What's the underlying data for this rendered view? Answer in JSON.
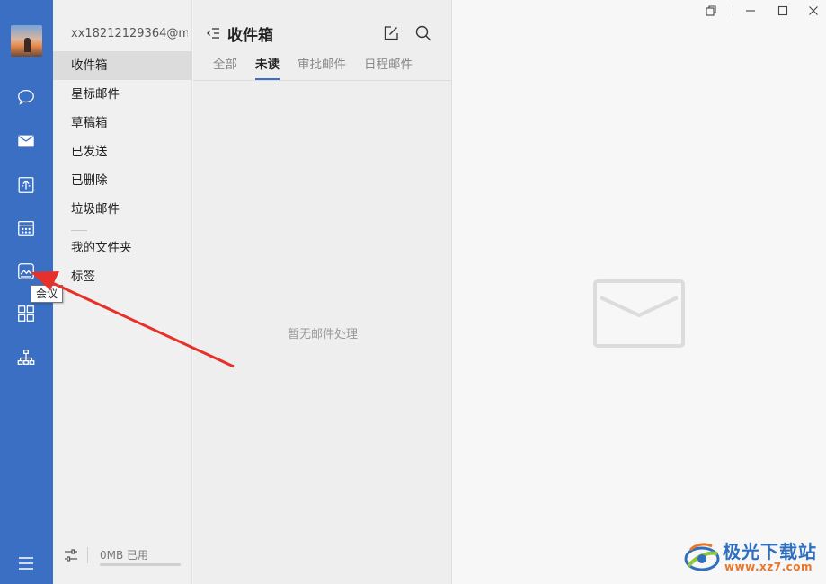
{
  "rail": {
    "items": [
      {
        "name": "chat",
        "icon": "chat-bubble-icon"
      },
      {
        "name": "mail",
        "icon": "mail-icon"
      },
      {
        "name": "docs",
        "icon": "document-icon"
      },
      {
        "name": "calendar",
        "icon": "calendar-icon"
      },
      {
        "name": "meeting",
        "icon": "meeting-icon"
      },
      {
        "name": "apps",
        "icon": "apps-grid-icon"
      },
      {
        "name": "org",
        "icon": "org-chart-icon"
      }
    ],
    "tooltip": "会议",
    "menu_icon": "hamburger-menu-icon"
  },
  "folders": {
    "account": "xx18212129364@m...",
    "items": [
      {
        "label": "收件箱",
        "active": true
      },
      {
        "label": "星标邮件"
      },
      {
        "label": "草稿箱"
      },
      {
        "label": "已发送"
      },
      {
        "label": "已删除"
      },
      {
        "label": "垃圾邮件"
      }
    ],
    "extra": [
      {
        "label": "我的文件夹"
      },
      {
        "label": "标签"
      }
    ],
    "storage": {
      "label": "0MB 已用",
      "used_fraction": 0
    }
  },
  "list": {
    "title": "收件箱",
    "tabs": [
      {
        "label": "全部"
      },
      {
        "label": "未读",
        "active": true
      },
      {
        "label": "审批邮件"
      },
      {
        "label": "日程邮件"
      }
    ],
    "empty_text": "暂无邮件处理"
  },
  "watermark": {
    "text": "极光下载站",
    "url": "www.xz7.com"
  },
  "colors": {
    "rail_bg": "#3b6fc4",
    "accent": "#3b6fc4",
    "arrow": "#e8302a"
  }
}
